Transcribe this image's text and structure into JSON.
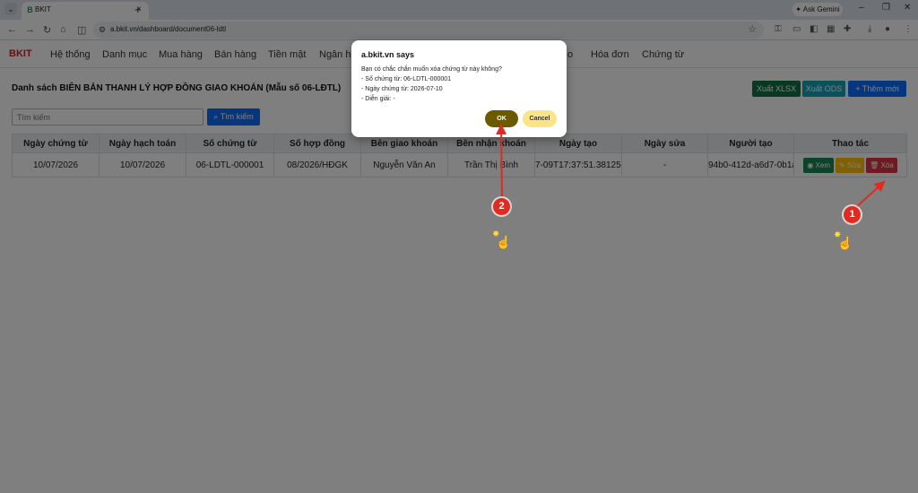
{
  "browser": {
    "tab_title": "BKIT",
    "favicon_letter": "B",
    "url": "a.bkit.vn/dashboard/document06-ldtl",
    "ask_gemini": "Ask Gemini"
  },
  "app": {
    "brand": "BKIT",
    "menu": [
      "Hệ thống",
      "Danh mục",
      "Mua hàng",
      "Bán hàng",
      "Tiền mặt",
      "Ngân hà",
      "o",
      "Hóa đơn",
      "Chứng từ"
    ]
  },
  "page": {
    "title": "Danh sách BIÊN BẢN THANH LÝ HỢP ĐỒNG GIAO KHOÁN (Mẫu số 06-LĐTL)",
    "export_xlsx": "Xuất XLSX",
    "export_ods": "Xuất ODS",
    "add_new": "+ Thêm mới",
    "search_placeholder": "Tìm kiếm",
    "search_button": "Tìm kiếm"
  },
  "table": {
    "headers": [
      "Ngày chứng từ",
      "Ngày hạch toán",
      "Số chứng từ",
      "Số hợp đồng",
      "Bên giao khoán",
      "Bên nhận khoán",
      "Ngày tạo",
      "Ngày sửa",
      "Người tạo",
      "Thao tác"
    ],
    "rows": [
      [
        "10/07/2026",
        "10/07/2026",
        "06-LDTL-000001",
        "08/2026/HĐGK",
        "Nguyễn Văn An",
        "Trần Thị Bình",
        "7-09T17:37:51.381252",
        "-",
        "94b0-412d-a6d7-0b1a"
      ]
    ],
    "actions": {
      "view": "Xem",
      "edit": "Sửa",
      "delete": "Xóa"
    }
  },
  "dialog": {
    "title": "a.bkit.vn says",
    "question": "Bạn có chắc chắn muốn xóa chứng từ này không?",
    "line_doc": "- Số chứng từ: 06-LDTL-000001",
    "line_date": "- Ngày chứng từ: 2026-07-10",
    "line_desc": "- Diễn giải: -",
    "ok": "OK",
    "cancel": "Cancel"
  },
  "annotations": {
    "marker_1": "1",
    "marker_2": "2",
    "marker_color": "#e02b20"
  }
}
